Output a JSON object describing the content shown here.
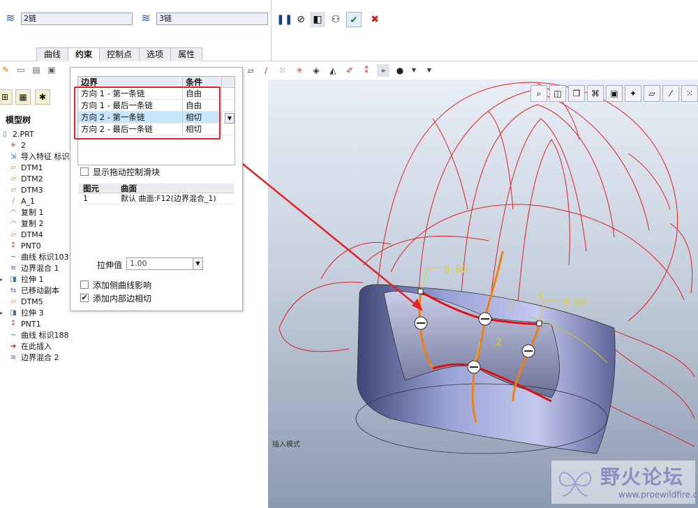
{
  "dashboard": {
    "chain1": "2链",
    "chain2": "3链",
    "pause_icon": "pause-icon",
    "tabs": [
      "曲线",
      "约束",
      "控制点",
      "选项",
      "属性"
    ],
    "active_tab": "约束"
  },
  "tree": {
    "title": "模型树",
    "items": [
      {
        "label": "2.PRT",
        "icon": "part-icon"
      },
      {
        "label": "2",
        "icon": "csys-icon"
      },
      {
        "label": "导入特征 标识",
        "icon": "import-icon"
      },
      {
        "label": "DTM1",
        "icon": "datum-plane-icon"
      },
      {
        "label": "DTM2",
        "icon": "datum-plane-icon"
      },
      {
        "label": "DTM3",
        "icon": "datum-plane-icon"
      },
      {
        "label": "A_1",
        "icon": "axis-icon"
      },
      {
        "label": "复制 1",
        "icon": "copy-surface-icon"
      },
      {
        "label": "复制 2",
        "icon": "copy-surface-icon"
      },
      {
        "label": "DTM4",
        "icon": "datum-plane-icon"
      },
      {
        "label": "PNT0",
        "icon": "datum-point-icon"
      },
      {
        "label": "曲线 标识103",
        "icon": "curve-icon"
      },
      {
        "label": "边界混合 1",
        "icon": "boundary-blend-icon"
      },
      {
        "label": "拉伸 1",
        "icon": "extrude-icon"
      },
      {
        "label": "已移动副本",
        "icon": "moved-copy-icon"
      },
      {
        "label": "DTM5",
        "icon": "datum-plane-icon"
      },
      {
        "label": "拉伸 3",
        "icon": "extrude-icon"
      },
      {
        "label": "PNT1",
        "icon": "datum-point-icon"
      },
      {
        "label": "曲线 标识188",
        "icon": "curve-icon"
      },
      {
        "label": "在此插入",
        "icon": "insert-here-icon"
      },
      {
        "label": "边界混合 2",
        "icon": "boundary-blend-icon"
      }
    ]
  },
  "constraints": {
    "col_boundary": "边界",
    "col_condition": "条件",
    "rows": [
      {
        "boundary": "方向 1 - 第一条链",
        "condition": "自由"
      },
      {
        "boundary": "方向 1 - 最后一条链",
        "condition": "自由"
      },
      {
        "boundary": "方向 2 - 第一条链",
        "condition": "相切"
      },
      {
        "boundary": "方向 2 - 最后一条链",
        "condition": "相切"
      }
    ],
    "show_drag_handles": "显示拖动控制滑块",
    "entity_col": "图元",
    "surface_col": "曲面",
    "entity_row": {
      "id": "1",
      "surface": "默认 曲面:F12(边界混合_1)"
    },
    "stretch_label": "拉伸值",
    "stretch_value": "1.00",
    "add_side_curve": "添加侧曲线影响",
    "add_inner_tangent": "添加内部边相切"
  },
  "viewport": {
    "mode_label": "插入模式",
    "dim1": "0.00",
    "dim2": "0.00",
    "label1": "1",
    "label2": "2",
    "watermark_title": "野火论坛",
    "watermark_url": "www.proewildfire.cn"
  }
}
